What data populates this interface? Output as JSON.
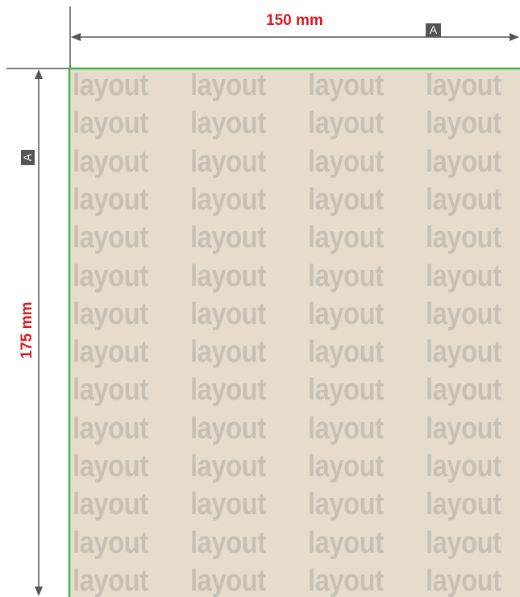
{
  "width_dimension": {
    "label": "150 mm",
    "marker": "A"
  },
  "height_dimension": {
    "label": "175 mm",
    "marker": "A"
  },
  "panel": {
    "repeated_word": "layout",
    "background_color": "#e7dccb",
    "text_color": "#c7c0b5",
    "edge_color": "#3db54a"
  },
  "colors": {
    "dimension_text": "#d71920",
    "dimension_line": "#555555",
    "marker_background": "#555555"
  }
}
